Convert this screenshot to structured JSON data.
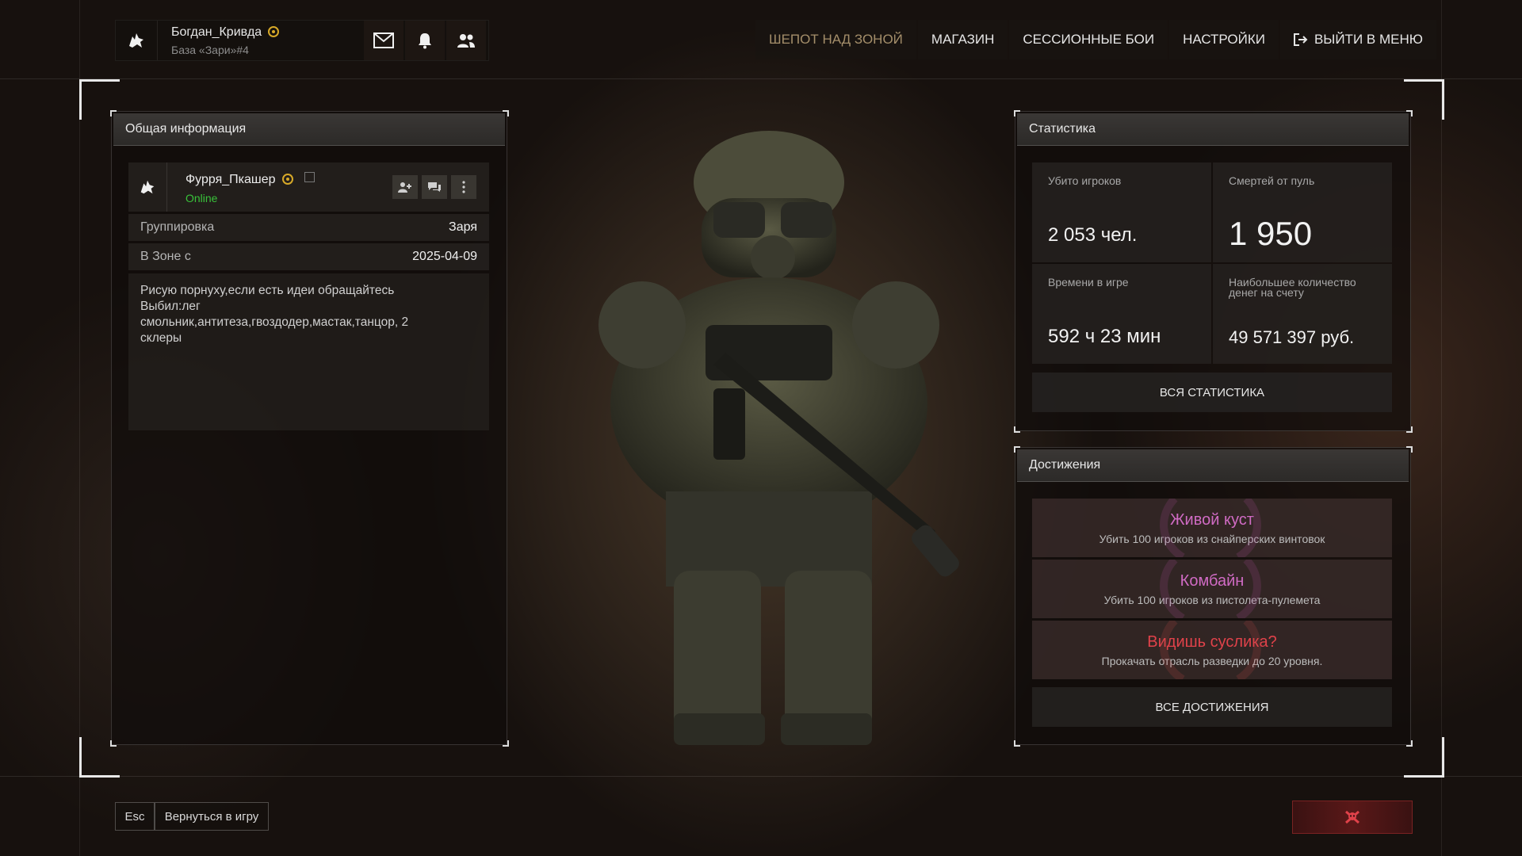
{
  "user": {
    "name": "Богдан_Кривда",
    "base": "База «Зари»#4",
    "icons": [
      "wolf-avatar-icon",
      "gold-badge-icon",
      "mail-icon",
      "bell-icon",
      "friends-icon"
    ]
  },
  "nav": {
    "items": [
      "ШЕПОТ НАД ЗОНОЙ",
      "МАГАЗИН",
      "СЕССИОННЫЕ БОИ",
      "НАСТРОЙКИ",
      "ВЫЙТИ В МЕНЮ"
    ],
    "active_index": 0,
    "exit_icon": "exit-icon"
  },
  "general": {
    "title": "Общая информация",
    "player_name": "Фурря_Пкашер",
    "status": "Online",
    "group_label": "Группировка",
    "group_value": "Заря",
    "since_label": "В Зоне с",
    "since_value": "2025-04-09",
    "bio_lines": [
      "Рисую порнуху,если есть идеи обращайтесь",
      "Выбил:лег",
      "смольник,антитеза,гвоздодер,мастак,танцор, 2",
      "склеры"
    ],
    "icons": [
      "add-friend-icon",
      "chat-icon",
      "more-icon",
      "copy-icon"
    ]
  },
  "stats": {
    "title": "Статистика",
    "kills_label": "Убито игроков",
    "kills_value": "2 053 чел.",
    "deaths_label": "Смертей от пуль",
    "deaths_value": "1 950",
    "time_label": "Времени в игре",
    "time_value": "592 ч 23 мин",
    "money_label_1": "Наибольшее количество",
    "money_label_2": "денег на счету",
    "money_value": "49 571 397 руб.",
    "all_button": "ВСЯ СТАТИСТИКА"
  },
  "achievements": {
    "title": "Достижения",
    "items": [
      {
        "name": "Живой куст",
        "desc": "Убить 100 игроков из снайперских винтовок",
        "color": "#d06bc4"
      },
      {
        "name": "Комбайн",
        "desc": "Убить 100 игроков из пистолета-пулемета",
        "color": "#d06bc4"
      },
      {
        "name": "Видишь суслика?",
        "desc": "Прокачать отрасль разведки до 20 уровня.",
        "color": "#e0424a"
      }
    ],
    "all_button": "ВСЕ ДОСТИЖЕНИЯ"
  },
  "footer": {
    "esc_key": "Esc",
    "back_label": "Вернуться в игру",
    "danger_icon": "skull-crossbones-icon"
  },
  "colors": {
    "accent_gold": "#d7a928",
    "online_green": "#39c23a",
    "nav_active": "#a48e6a",
    "danger_red": "#e0424a"
  }
}
